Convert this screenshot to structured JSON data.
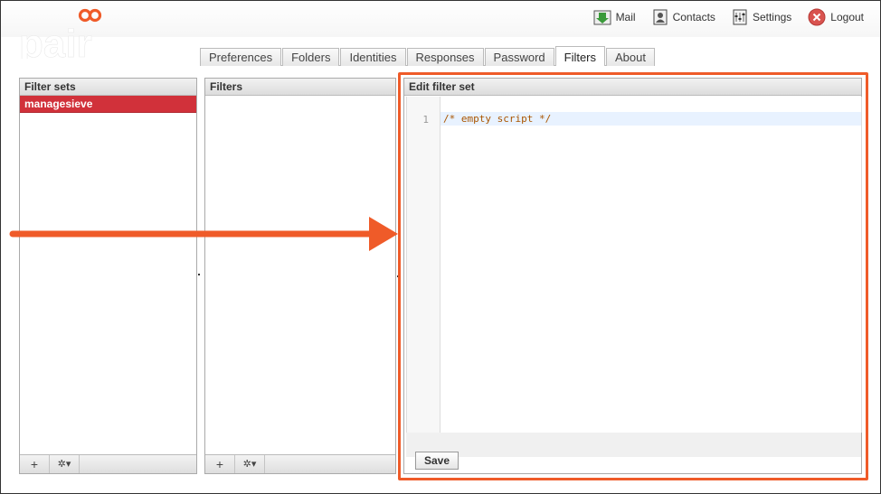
{
  "brand": {
    "logo_text": "pair",
    "accent": "#ef5b29"
  },
  "topnav": [
    {
      "label": "Mail",
      "icon": "mail-icon"
    },
    {
      "label": "Contacts",
      "icon": "contacts-icon"
    },
    {
      "label": "Settings",
      "icon": "settings-icon"
    },
    {
      "label": "Logout",
      "icon": "logout-icon"
    }
  ],
  "tabs": [
    {
      "label": "Preferences"
    },
    {
      "label": "Folders"
    },
    {
      "label": "Identities"
    },
    {
      "label": "Responses"
    },
    {
      "label": "Password"
    },
    {
      "label": "Filters",
      "active": true
    },
    {
      "label": "About"
    }
  ],
  "filter_sets": {
    "header": "Filter sets",
    "items": [
      "managesieve"
    ],
    "add_label": "+",
    "menu_label": "✲▾"
  },
  "filters": {
    "header": "Filters",
    "add_label": "+",
    "menu_label": "✲▾"
  },
  "edit": {
    "header": "Edit filter set",
    "line_number": "1",
    "code": "/* empty script */",
    "save_label": "Save"
  }
}
